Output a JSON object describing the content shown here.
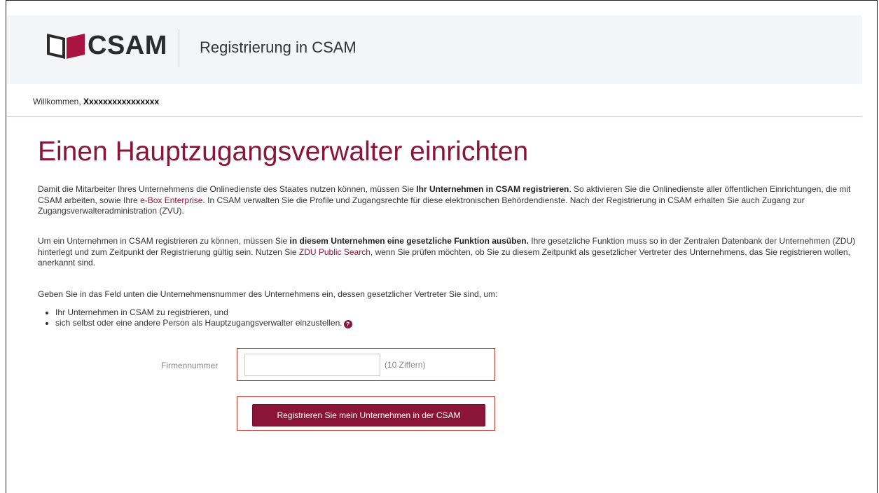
{
  "header": {
    "logo_text": "CSAM",
    "title": "Registrierung in CSAM"
  },
  "welcome": {
    "label": "Willkommen,",
    "username": "Xxxxxxxxxxxxxxxx"
  },
  "main": {
    "title": "Einen Hauptzugangsverwalter einrichten",
    "p1": {
      "t1": "Damit die Mitarbeiter Ihres Unternehmens die Onlinedienste des Staates nutzen können, müssen Sie ",
      "b1": "Ihr Unternehmen in CSAM registrieren",
      "t2": ". So aktivieren Sie die Onlinedienste aller öffentlichen Einrichtungen, die mit CSAM arbeiten, sowie Ihre ",
      "link": "e-Box Enterprise",
      "t3": ". In CSAM verwalten Sie die Profile und Zugangsrechte für diese elektronischen Behördendienste. Nach der Registrierung in CSAM erhalten Sie auch Zugang zur Zugangsverwalteradministration (ZVU)."
    },
    "p2": {
      "t1": "Um ein Unternehmen in CSAM registrieren zu können, müssen Sie ",
      "b1": "in diesem Unternehmen eine gesetzliche Funktion ausüben.",
      "t2": " Ihre gesetzliche Funktion muss so in der Zentralen Datenbank der Unternehmen (ZDU) hinterlegt und zum Zeitpunkt der Registrierung gültig sein. Nutzen Sie ",
      "link": "ZDU Public Search",
      "t3": ", wenn Sie prüfen möchten, ob Sie zu diesem Zeitpunkt als gesetzlicher Vertreter des Unternehmens, das Sie registrieren wollen, anerkannt sind."
    },
    "p3": "Geben Sie in das Feld unten die Unternehmensnummer des Unternehmens ein, dessen gesetzlicher Vertreter Sie sind, um:",
    "bullets": [
      "Ihr Unternehmen in CSAM zu registrieren, und",
      "sich selbst oder eine andere Person als Hauptzugangsverwalter einzustellen."
    ],
    "help_glyph": "?"
  },
  "form": {
    "label": "Firmennummer",
    "value": "",
    "hint": "(10 Ziffern)",
    "submit_label": "Registrieren Sie mein Unternehmen in der CSAM"
  },
  "colors": {
    "brand": "#8a1538",
    "highlight_border": "#c0392b",
    "header_bg": "#f4f5f7"
  }
}
